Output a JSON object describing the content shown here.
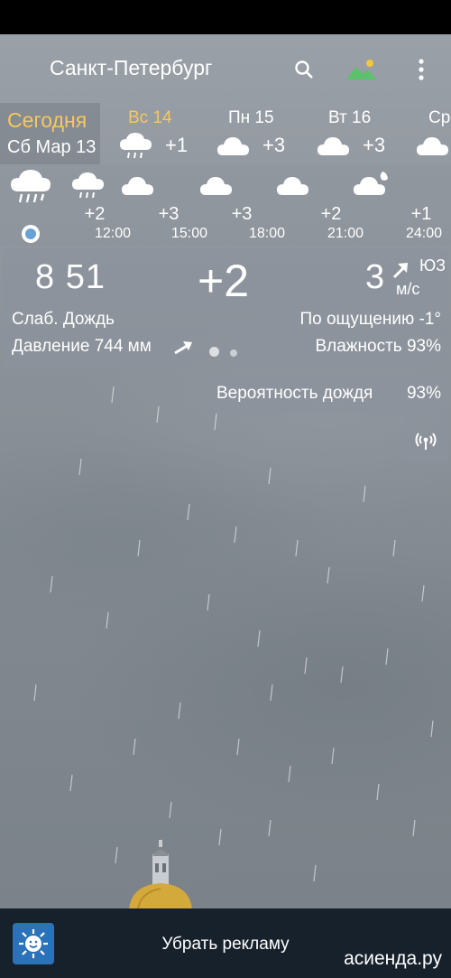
{
  "header": {
    "city": "Санкт-Петербург",
    "search_icon": "search-icon",
    "wallpaper_icon": "landscape-icon",
    "menu_icon": "more-vert-icon"
  },
  "days": {
    "today_label": "Сегодня",
    "today_date": "Сб Мар 13",
    "items": [
      {
        "name": "Вс 14",
        "temp": "+1",
        "icon": "cloud-rain-icon"
      },
      {
        "name": "Пн 15",
        "temp": "+3",
        "icon": "cloud-icon"
      },
      {
        "name": "Вт 16",
        "temp": "+3",
        "icon": "cloud-icon"
      },
      {
        "name": "Ср",
        "temp": "",
        "icon": "cloud-icon"
      }
    ]
  },
  "hourly": [
    {
      "temp": "+2",
      "time": "12:00",
      "icon": "cloud-rain-icon"
    },
    {
      "temp": "+3",
      "time": "15:00",
      "icon": "cloud-icon"
    },
    {
      "temp": "+3",
      "time": "18:00",
      "icon": "cloud-icon"
    },
    {
      "temp": "+2",
      "time": "21:00",
      "icon": "cloud-icon"
    },
    {
      "temp": "+1",
      "time": "24:00",
      "icon": "cloud-moon-icon"
    }
  ],
  "current": {
    "time": "8 51",
    "temp": "+2",
    "wind_speed": "3",
    "wind_dir": "ЮЗ",
    "wind_unit": "м/с",
    "condition": "Слаб. Дождь",
    "feels_like": "По ощущению -1°",
    "pressure": "Давление 744 мм",
    "humidity": "Влажность 93%"
  },
  "precip": {
    "label": "Вероятность дождя",
    "value": "93%"
  },
  "radar_icon": "radar-icon",
  "bottom": {
    "app_icon": "sun-face-icon",
    "remove_ads": "Убрать рекламу",
    "watermark": "асиенда.ру"
  },
  "colors": {
    "today_accent": "#f5c860",
    "now_dot": "#6aa2d6",
    "bottom_bar": "#17212c",
    "app_icon_bg": "#2c72b8"
  }
}
